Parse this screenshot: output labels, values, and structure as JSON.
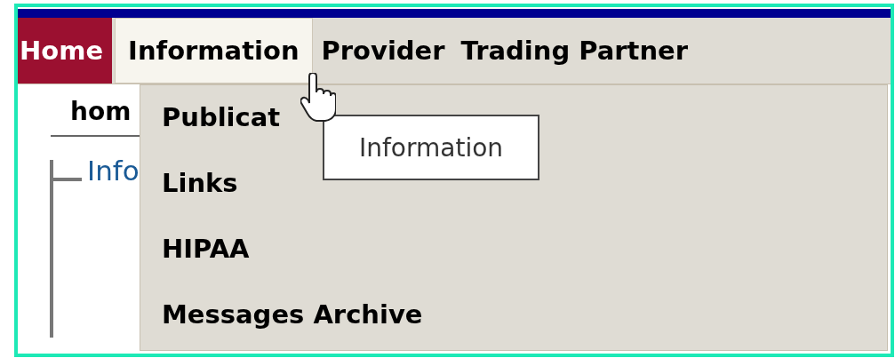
{
  "menu": [
    {
      "label": "Home",
      "current": true,
      "open": false
    },
    {
      "label": "Information",
      "current": false,
      "open": true
    },
    {
      "label": "Provider",
      "current": false,
      "open": false
    },
    {
      "label": "Trading Partner",
      "current": false,
      "open": false
    }
  ],
  "breadcrumb": "hom",
  "section_legend": "Info",
  "dropdown": [
    "Publicat",
    "Links",
    "HIPAA",
    "Messages Archive"
  ],
  "tooltip": "Information"
}
